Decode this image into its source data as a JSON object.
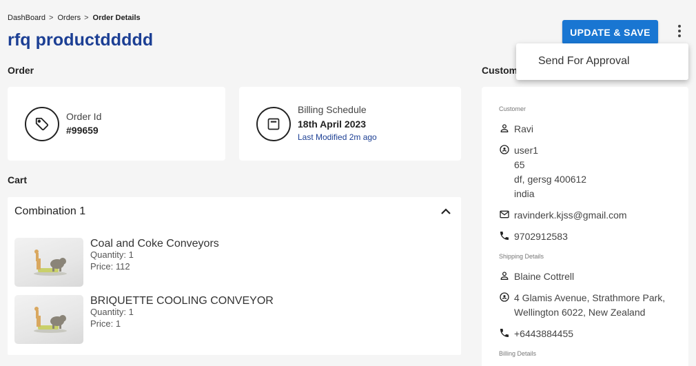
{
  "breadcrumb": {
    "items": [
      "DashBoard",
      "Orders",
      "Order Details"
    ],
    "separator": ">"
  },
  "page_title": "rfq productddddd",
  "actions": {
    "update_save_label": "UPDATE & SAVE",
    "more_icon": "more-vert-icon",
    "menu": [
      "Send For Approval"
    ]
  },
  "sections": {
    "order": "Order",
    "cart": "Cart",
    "customer": "Customer"
  },
  "order_card": {
    "label": "Order Id",
    "value": "#99659",
    "icon": "tag-icon"
  },
  "billing_card": {
    "label": "Billing Schedule",
    "value": "18th April 2023",
    "modified": "Last Modified 2m ago",
    "icon": "calendar-icon"
  },
  "cart": {
    "combination_title": "Combination 1",
    "items": [
      {
        "name": "Coal and Coke Conveyors",
        "quantity": "Quantity: 1",
        "price": "Price: 112"
      },
      {
        "name": "BRIQUETTE COOLING CONVEYOR",
        "quantity": "Quantity: 1",
        "price": "Price: 1"
      }
    ]
  },
  "customer": {
    "customer_heading": "Customer",
    "name": "Ravi",
    "address_lines": [
      "user1",
      "65",
      "df, gersg 400612",
      "india"
    ],
    "email": "ravinderk.kjss@gmail.com",
    "phone": "9702912583",
    "shipping_heading": "Shipping Details",
    "shipping_name": "Blaine Cottrell",
    "shipping_address_lines": [
      "4 Glamis Avenue, Strathmore Park,",
      "Wellington 6022, New Zealand"
    ],
    "shipping_phone": "+6443884455",
    "billing_heading": "Billing Details"
  },
  "colors": {
    "primary": "#1976d2",
    "title": "#1c3f94",
    "background": "#f5f5f5"
  }
}
